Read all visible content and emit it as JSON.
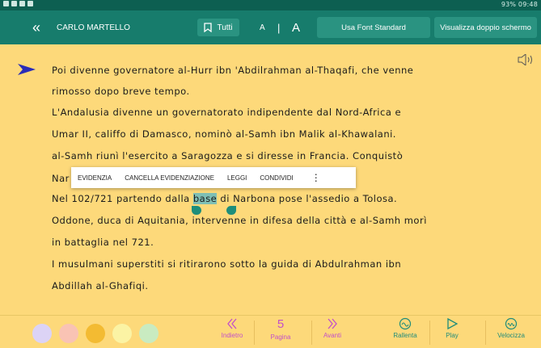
{
  "status_bar": {
    "right_text": "93% 09:48"
  },
  "toolbar": {
    "user_name": "CARLO MARTELLO",
    "bookmark_label": "Tutti",
    "font_small": "A",
    "font_separator": "|",
    "font_large": "A",
    "standard_font": "Usa Font Standard",
    "dual_screen": "Visualizza doppio schermo"
  },
  "text": {
    "line1": "Poi divenne governatore al-Hurr ibn 'Abdilrahman al-Thaqafi, che venne",
    "line2": "rimosso dopo breve tempo.",
    "line3": "L'Andalusia divenne un governatorato indipendente dal Nord-Africa e",
    "line4": "Umar II, califfo di Damasco, nominò al-Samh ibn Malik al-Khawalani.",
    "line5": "al-Samh riunì l'esercito a Saragozza e si diresse in Francia. Conquistò",
    "line6": "Nar",
    "line7_before": "Nel 102/721 partendo dalla ",
    "line7_selected": "base",
    "line7_after": " di Narbona pose l'assedio a Tolosa.",
    "line8": "Oddone, duca di Aquitania, intervenne in difesa della città e al-Samh morì",
    "line9": "in battaglia nel 721.",
    "line10": "I musulmani superstiti si ritirarono sotto la guida di Abdulrahman ibn",
    "line11": "Abdillah al-Ghafiqi."
  },
  "context_menu": {
    "highlight": "EVIDENZIA",
    "clear_highlight": "CANCELLA EVIDENZIAZIONE",
    "read": "LEGGI",
    "share": "CONDIVIDI",
    "more": "⋮"
  },
  "bottom_bar": {
    "swatches": [
      "#dcd3f5",
      "#f9c3b4",
      "#f3bb32",
      "#fbf3a4",
      "#c9ebc1"
    ],
    "prev_label": "Indietro",
    "page_number": "5",
    "page_label": "Pagina",
    "next_label": "Avanti",
    "slow_label": "Rallenta",
    "play_label": "Play",
    "speed_label": "Velocizza"
  },
  "colors": {
    "toolbar": "#177c6c",
    "page_background": "#fdd97a",
    "accent_teal": "#1f8c7a",
    "accent_pink": "#c34fc9",
    "pointer": "#2a2cb8"
  }
}
